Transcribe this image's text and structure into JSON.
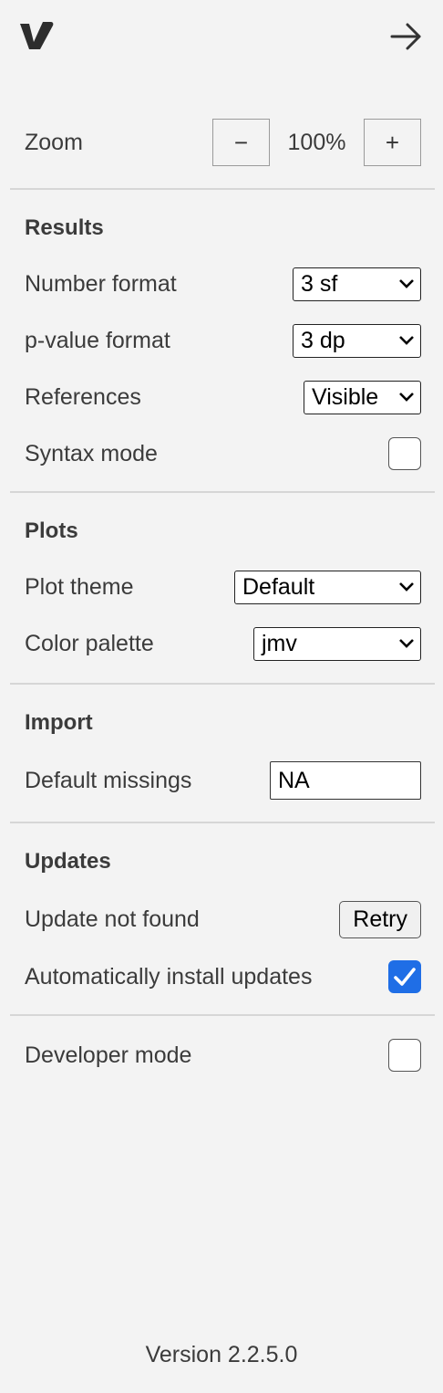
{
  "zoom": {
    "label": "Zoom",
    "decrease": "−",
    "value": "100%",
    "increase": "+"
  },
  "results": {
    "title": "Results",
    "number_format": {
      "label": "Number format",
      "value": "3 sf"
    },
    "pvalue_format": {
      "label": "p-value format",
      "value": "3 dp"
    },
    "references": {
      "label": "References",
      "value": "Visible"
    },
    "syntax_mode": {
      "label": "Syntax mode",
      "checked": false
    }
  },
  "plots": {
    "title": "Plots",
    "theme": {
      "label": "Plot theme",
      "value": "Default"
    },
    "palette": {
      "label": "Color palette",
      "value": "jmv"
    }
  },
  "import": {
    "title": "Import",
    "missings": {
      "label": "Default missings",
      "value": "NA"
    }
  },
  "updates": {
    "title": "Updates",
    "status": {
      "label": "Update not found",
      "button": "Retry"
    },
    "auto_install": {
      "label": "Automatically install updates",
      "checked": true
    }
  },
  "developer": {
    "label": "Developer mode",
    "checked": false
  },
  "footer": {
    "version": "Version 2.2.5.0"
  },
  "colors": {
    "accent": "#1f6ee6",
    "background": "#f3f3f3",
    "text": "#3b3b3b"
  },
  "icons": {
    "logo": "jamovi-logo",
    "back": "arrow-right-icon"
  }
}
